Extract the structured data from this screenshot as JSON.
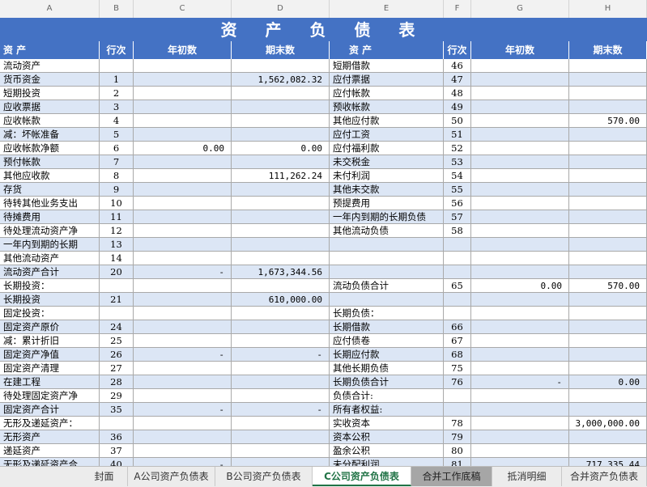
{
  "columns": [
    "A",
    "B",
    "C",
    "D",
    "E",
    "F",
    "G",
    "H"
  ],
  "title": "资 产 负 债 表",
  "headers": {
    "asset_item": "资                 产",
    "row_no": "行次",
    "begin": "年初数",
    "end": "期末数",
    "liab_item": "资                 产",
    "row_no2": "行次",
    "begin2": "年初数",
    "end2": "期末数"
  },
  "rows": [
    {
      "a": "流动资产",
      "b": "",
      "c": "",
      "d": "",
      "e": "短期借款",
      "f": "46",
      "g": "",
      "h": ""
    },
    {
      "a": "  货币资金",
      "b": "1",
      "c": "",
      "d": "1,562,082.32",
      "e": "应付票据",
      "f": "47",
      "g": "",
      "h": ""
    },
    {
      "a": "  短期投资",
      "b": "2",
      "c": "",
      "d": "",
      "e": "应付帐款",
      "f": "48",
      "g": "",
      "h": ""
    },
    {
      "a": "  应收票据",
      "b": "3",
      "c": "",
      "d": "",
      "e": "预收帐款",
      "f": "49",
      "g": "",
      "h": ""
    },
    {
      "a": "  应收帐款",
      "b": "4",
      "c": "",
      "d": "",
      "e": "其他应付款",
      "f": "50",
      "g": "",
      "h": "570.00"
    },
    {
      "a": "    减：坏帐准备",
      "b": "5",
      "c": "",
      "d": "",
      "e": "应付工资",
      "f": "51",
      "g": "",
      "h": ""
    },
    {
      "a": "  应收帐款净额",
      "b": "6",
      "c": "0.00",
      "d": "0.00",
      "e": "应付福利款",
      "f": "52",
      "g": "",
      "h": ""
    },
    {
      "a": "  预付帐款",
      "b": "7",
      "c": "",
      "d": "",
      "e": "未交税金",
      "f": "53",
      "g": "",
      "h": ""
    },
    {
      "a": "  其他应收款",
      "b": "8",
      "c": "",
      "d": "111,262.24",
      "e": "未付利润",
      "f": "54",
      "g": "",
      "h": ""
    },
    {
      "a": "  存货",
      "b": "9",
      "c": "",
      "d": "",
      "e": "其他未交款",
      "f": "55",
      "g": "",
      "h": ""
    },
    {
      "a": "  待转其他业务支出",
      "b": "10",
      "c": "",
      "d": "",
      "e": "预提费用",
      "f": "56",
      "g": "",
      "h": ""
    },
    {
      "a": "  待摊费用",
      "b": "11",
      "c": "",
      "d": "",
      "e": "一年内到期的长期负债",
      "f": "57",
      "g": "",
      "h": ""
    },
    {
      "a": "  待处理流动资产净",
      "b": "12",
      "c": "",
      "d": "",
      "e": "其他流动负债",
      "f": "58",
      "g": "",
      "h": ""
    },
    {
      "a": "  一年内到期的长期",
      "b": "13",
      "c": "",
      "d": "",
      "e": "",
      "f": "",
      "g": "",
      "h": ""
    },
    {
      "a": "  其他流动资产",
      "b": "14",
      "c": "",
      "d": "",
      "e": "",
      "f": "",
      "g": "",
      "h": ""
    },
    {
      "a": "    流动资产合计",
      "b": "20",
      "c": "-",
      "d": "1,673,344.56",
      "e": "",
      "f": "",
      "g": "",
      "h": ""
    },
    {
      "a": "长期投资：",
      "b": "",
      "c": "",
      "d": "",
      "e": "    流动负债合计",
      "f": "65",
      "g": "0.00",
      "h": "570.00"
    },
    {
      "a": "    长期投资",
      "b": "21",
      "c": "",
      "d": "610,000.00",
      "e": "",
      "f": "",
      "g": "",
      "h": ""
    },
    {
      "a": "固定投资：",
      "b": "",
      "c": "",
      "d": "",
      "e": "长期负债：",
      "f": "",
      "g": "",
      "h": ""
    },
    {
      "a": "  固定资产原价",
      "b": "24",
      "c": "",
      "d": "",
      "e": "  长期借款",
      "f": "66",
      "g": "",
      "h": ""
    },
    {
      "a": "  减：累计折旧",
      "b": "25",
      "c": "",
      "d": "",
      "e": "  应付债卷",
      "f": "67",
      "g": "",
      "h": ""
    },
    {
      "a": "  固定资产净值",
      "b": "26",
      "c": "-",
      "d": "-",
      "e": "  长期应付款",
      "f": "68",
      "g": "",
      "h": ""
    },
    {
      "a": "  固定资产清理",
      "b": "27",
      "c": "",
      "d": "",
      "e": "  其他长期负债",
      "f": "75",
      "g": "",
      "h": ""
    },
    {
      "a": "  在建工程",
      "b": "28",
      "c": "",
      "d": "",
      "e": "  长期负债合计",
      "f": "76",
      "g": "-",
      "h": "0.00"
    },
    {
      "a": "  待处理固定资产净",
      "b": "29",
      "c": "",
      "d": "",
      "e": "负债合计:",
      "f": "",
      "g": "",
      "h": ""
    },
    {
      "a": "    固定资产合计",
      "b": "35",
      "c": "-",
      "d": "-",
      "e": "所有者权益:",
      "f": "",
      "g": "",
      "h": ""
    },
    {
      "a": "无形及递延资产：",
      "b": "",
      "c": "",
      "d": "",
      "e": "  实收资本",
      "f": "78",
      "g": "",
      "h": "3,000,000.00"
    },
    {
      "a": "  无形资产",
      "b": "36",
      "c": "",
      "d": "",
      "e": "  资本公积",
      "f": "79",
      "g": "",
      "h": ""
    },
    {
      "a": "  递延资产",
      "b": "37",
      "c": "",
      "d": "",
      "e": "  盈余公积",
      "f": "80",
      "g": "",
      "h": ""
    },
    {
      "a": "    无形及递延资产合",
      "b": "40",
      "c": "-",
      "d": "",
      "e": "  未分配利润",
      "f": "81",
      "g": "",
      "h": "717,335.44"
    }
  ],
  "sheet_tabs": [
    {
      "label": "封面",
      "state": "normal"
    },
    {
      "label": "A公司资产负债表",
      "state": "normal"
    },
    {
      "label": "B公司资产负债表",
      "state": "normal"
    },
    {
      "label": "C公司资产负债表",
      "state": "active"
    },
    {
      "label": "合并工作底稿",
      "state": "dark"
    },
    {
      "label": "抵消明细",
      "state": "normal"
    },
    {
      "label": "合并资产负债表",
      "state": "normal"
    }
  ]
}
